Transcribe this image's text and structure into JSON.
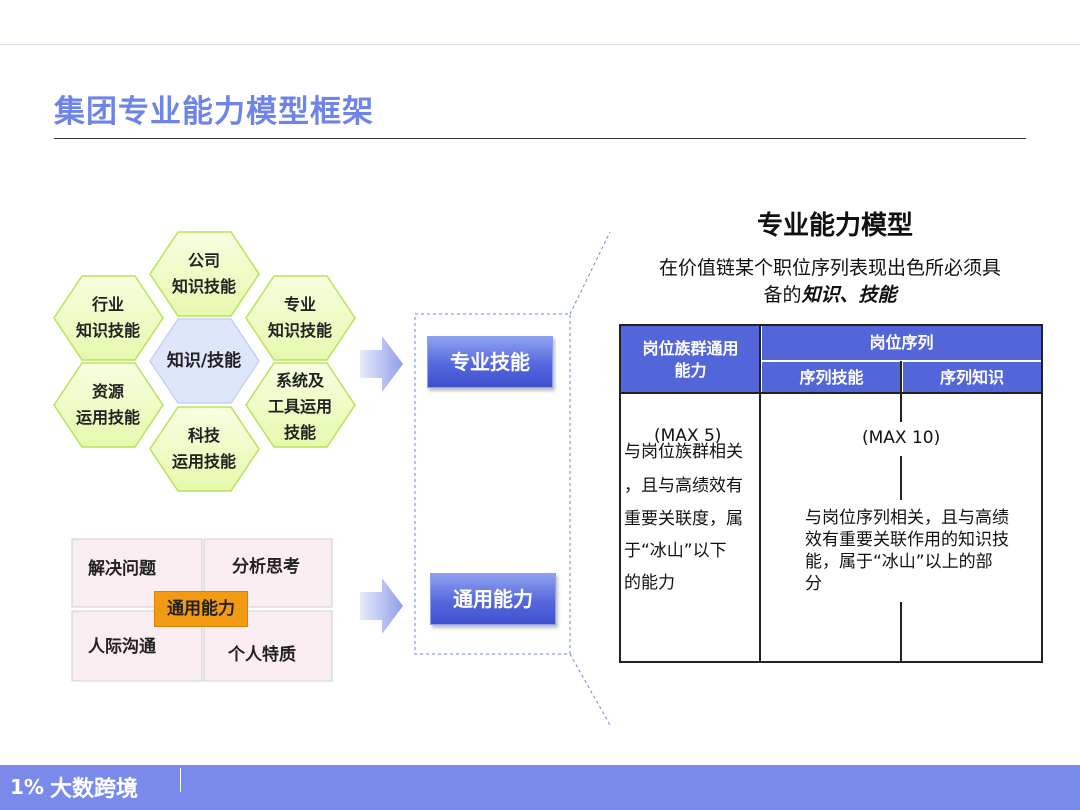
{
  "slide": {
    "title": "集团专业能力模型框架"
  },
  "hexagons": {
    "center": "知识/技能",
    "top": "公司\n知识技能",
    "upper_left": "行业\n知识技能",
    "upper_right": "专业\n知识技能",
    "lower_left": "资源\n运用技能",
    "lower_right": "系统及\n工具运用\n技能",
    "bottom": "科技\n运用技能"
  },
  "general_grid": {
    "top_left": "解决问题",
    "top_right": "分析思考",
    "bottom_left": "人际沟通",
    "bottom_right": "个人特质",
    "center": "通用能力"
  },
  "buttons": {
    "professional": "专业技能",
    "general": "通用能力"
  },
  "model": {
    "heading": "专业能力模型",
    "desc_line1": "在价值链某个职位序列表现出色所必须具",
    "desc_line2_prefix": "备的",
    "desc_line2_emphasis": "知识、技能"
  },
  "table": {
    "col1_header": "岗位族群通用能力",
    "group_header": "岗位序列",
    "col2_header": "序列技能",
    "col3_header": "序列知识",
    "col1_max": "(MAX 5)",
    "col23_max": "(MAX 10)",
    "col1_text_lines": [
      "与岗位族群相关",
      "，且与高绩效有",
      "重要关联度，属",
      "于“冰山”以下",
      "的能力"
    ],
    "col23_text_lines": [
      "与岗位序列相关，且与高绩",
      "效有重要关联作用的知识技",
      "能，属于“冰山”以上的部",
      "分"
    ]
  },
  "footer": {
    "brand": "大数跨境",
    "logo_mark": "1%"
  },
  "colors": {
    "accent": "#6f84e8",
    "button_blue": "#5266d9",
    "hex_green": "#eefcc4",
    "hex_center": "#dfe5fb",
    "badge_orange": "#f39a13",
    "footer": "#7a8aeb"
  }
}
